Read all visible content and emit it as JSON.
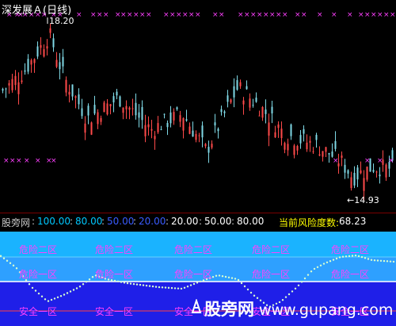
{
  "window": {
    "title": "深发展Ａ(日线)"
  },
  "price_chart": {
    "high_label": "18.20",
    "low_label": "←14.93",
    "colors": {
      "up": "#ff4a4a",
      "down": "#7fd9e6",
      "marker": "#ff40ff"
    }
  },
  "indicator": {
    "name": "股旁网",
    "levels": [
      "100.00",
      "80.00",
      "50.00",
      "20.00",
      "20.00",
      "50.00",
      "80.00"
    ],
    "level_colors": [
      "#00c8ff",
      "#00c8ff",
      "#3a5cff",
      "#3a5cff",
      "#ffffff",
      "#ffffff",
      "#ffffff"
    ],
    "risk_label": "当前风险度数:",
    "risk_value": "68.23",
    "zones": {
      "danger2": "危险二区",
      "danger1": "危险一区",
      "safe1": "安全一区",
      "safe2": "安全二区"
    },
    "colors": {
      "upper_zone": "#1ab3ff",
      "mid_zone": "#2ea0ff",
      "lower_zone": "#1f1fe8",
      "line": "#d8ffd0"
    }
  },
  "watermark": {
    "chinese": "股旁网",
    "url": "www.gupang.com"
  }
}
